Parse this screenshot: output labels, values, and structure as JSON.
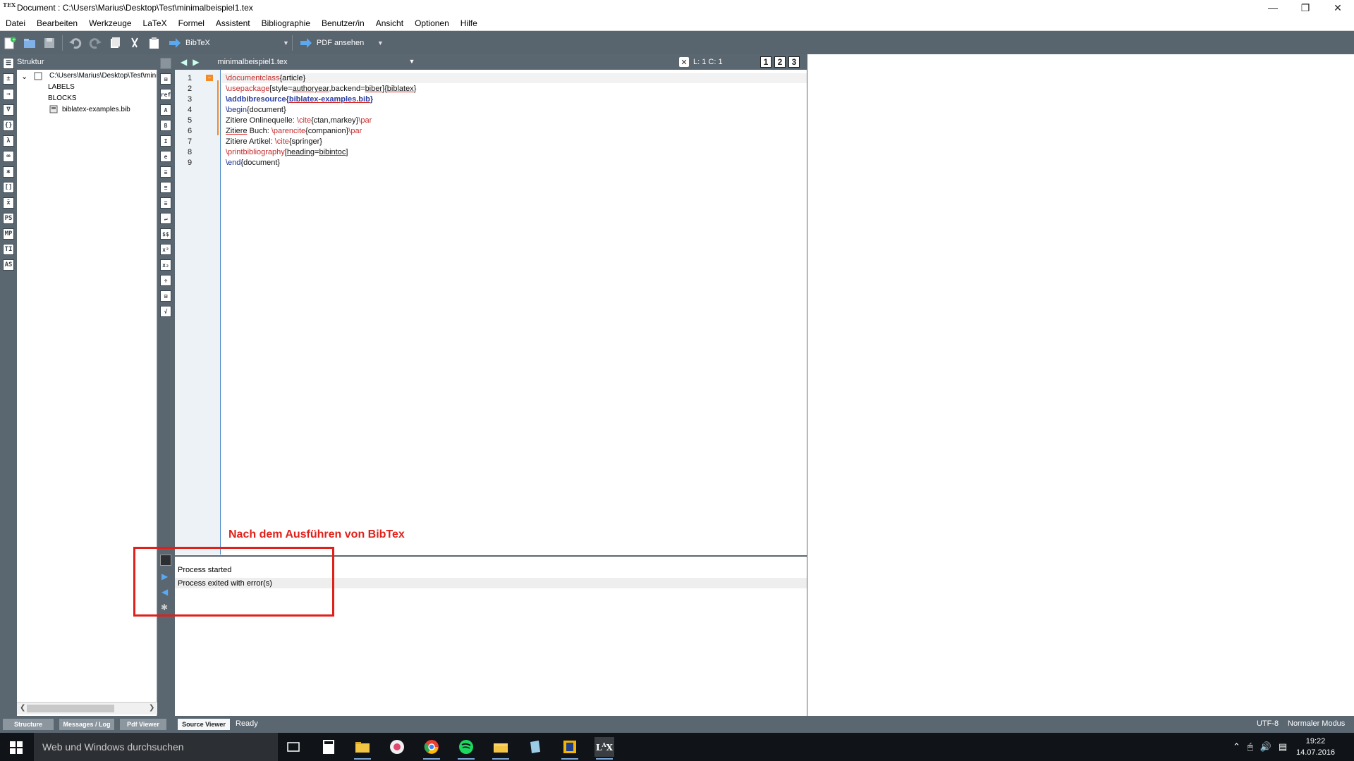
{
  "window": {
    "title": "Document : C:\\Users\\Marius\\Desktop\\Test\\minimalbeispiel1.tex",
    "logo": "TEX"
  },
  "menu": [
    "Datei",
    "Bearbeiten",
    "Werkzeuge",
    "LaTeX",
    "Formel",
    "Assistent",
    "Bibliographie",
    "Benutzer/in",
    "Ansicht",
    "Optionen",
    "Hilfe"
  ],
  "toolbar": {
    "build_label": "BibTeX",
    "view_label": "PDF ansehen"
  },
  "structure": {
    "header": "Struktur",
    "root": "C:\\Users\\Marius\\Desktop\\Test\\minimalbeispiel1.tex",
    "labels": "LABELS",
    "blocks": "BLOCKS",
    "bib": "biblatex-examples.bib"
  },
  "left_strip_icons": [
    "☰",
    "±",
    "⇒",
    "∇",
    "{}",
    "λ",
    "∞",
    "✱",
    "[]",
    "x̄",
    "PS",
    "MP",
    "TI",
    "AS"
  ],
  "mid_strip_icons": [
    "⊞",
    "ref",
    "A",
    "B",
    "I",
    "e",
    "≡",
    "≡",
    "≡",
    "↵",
    "$$",
    "x²",
    "x₂",
    "÷",
    "⊞",
    "√"
  ],
  "editor": {
    "file_name": "minimalbeispiel1.tex",
    "cursor": "L: 1 C: 1",
    "view_buttons": [
      "1",
      "2",
      "3"
    ],
    "lines": [
      {
        "n": "1",
        "segs": [
          [
            "kw",
            "\\documentclass"
          ],
          [
            "",
            "{article}"
          ]
        ]
      },
      {
        "n": "2",
        "segs": [
          [
            "kw",
            "\\usepackage"
          ],
          [
            "",
            "[style="
          ],
          [
            "ul",
            "authoryear"
          ],
          [
            "",
            ",backend="
          ],
          [
            "ul",
            "biber"
          ],
          [
            "",
            "]{"
          ],
          [
            "ul",
            "biblatex"
          ],
          [
            "",
            "}"
          ]
        ]
      },
      {
        "n": "3",
        "segs": [
          [
            "kw-b",
            "\\addbibresource"
          ],
          [
            "kw-b",
            "{"
          ],
          [
            "kw-b ul",
            "biblatex-examples.bib"
          ],
          [
            "kw-b",
            "}"
          ]
        ]
      },
      {
        "n": "4",
        "segs": [
          [
            "bl",
            "\\begin"
          ],
          [
            "",
            "{document}"
          ]
        ]
      },
      {
        "n": "5",
        "segs": [
          [
            "",
            "Zitiere Onlinequelle: "
          ],
          [
            "kw",
            "\\cite"
          ],
          [
            "",
            "{ctan,markey}"
          ],
          [
            "kw",
            "\\par"
          ]
        ]
      },
      {
        "n": "6",
        "segs": [
          [
            "ul",
            "Zitiere"
          ],
          [
            "",
            " Buch: "
          ],
          [
            "kw",
            "\\parencite"
          ],
          [
            "",
            "{companion}"
          ],
          [
            "kw",
            "\\par"
          ]
        ]
      },
      {
        "n": "7",
        "segs": [
          [
            "",
            "Zitiere Artikel: "
          ],
          [
            "kw",
            "\\cite"
          ],
          [
            "",
            "{springer}"
          ]
        ]
      },
      {
        "n": "8",
        "segs": [
          [
            "kw",
            "\\printbibliography"
          ],
          [
            "",
            "["
          ],
          [
            "ul",
            "heading"
          ],
          [
            "",
            "="
          ],
          [
            "ul",
            "bibintoc"
          ],
          [
            "",
            "]"
          ]
        ]
      },
      {
        "n": "9",
        "segs": [
          [
            "bl",
            "\\end"
          ],
          [
            "",
            "{document}"
          ]
        ]
      }
    ]
  },
  "annotation": "Nach dem Ausführen von BibTex",
  "log": {
    "line1": "Process started",
    "line2": "Process exited with error(s)"
  },
  "status": {
    "tabs": [
      "Structure",
      "Messages / Log",
      "Pdf Viewer",
      "Source Viewer"
    ],
    "ready": "Ready",
    "encoding": "UTF-8",
    "mode": "Normaler Modus"
  },
  "taskbar": {
    "search_placeholder": "Web und Windows durchsuchen",
    "time": "19:22",
    "date": "14.07.2016"
  }
}
